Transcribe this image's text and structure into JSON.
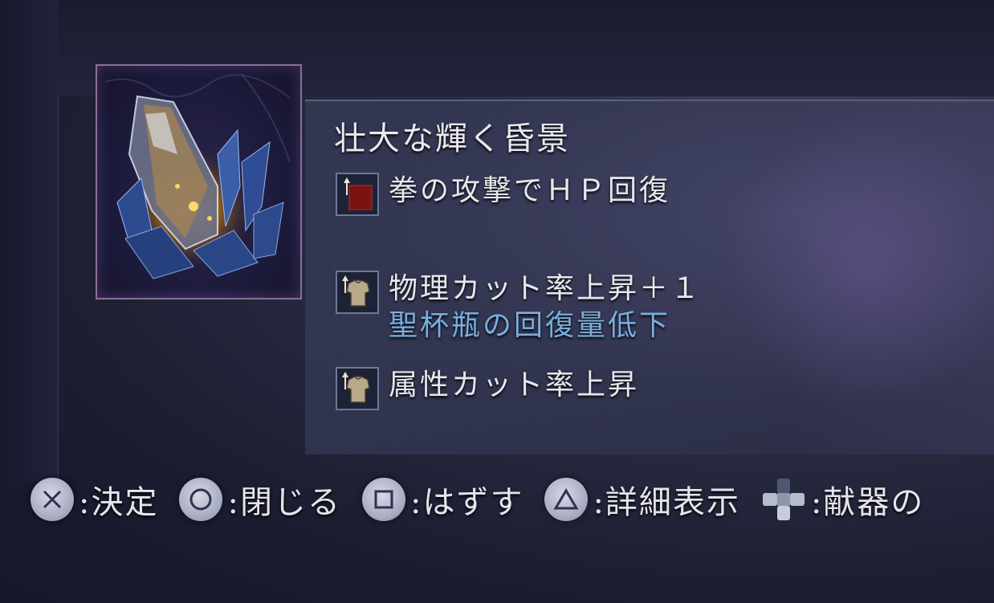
{
  "relic": {
    "name": "壮大な輝く昏景",
    "effects": [
      {
        "text": "拳の攻撃でＨＰ回復",
        "sub": "",
        "icon": "red-square-up-arrow-icon"
      },
      {
        "text": "物理カット率上昇＋１",
        "sub": "聖杯瓶の回復量低下",
        "icon": "armor-up-arrow-icon"
      },
      {
        "text": "属性カット率上昇",
        "sub": "",
        "icon": "armor-up-arrow-icon"
      }
    ]
  },
  "controls": [
    {
      "button": "cross-button-icon",
      "label": ":決定"
    },
    {
      "button": "circle-button-icon",
      "label": ":閉じる"
    },
    {
      "button": "square-button-icon",
      "label": ":はずす"
    },
    {
      "button": "triangle-button-icon",
      "label": ":詳細表示"
    },
    {
      "button": "dpad-icon",
      "label": ":献器の"
    }
  ],
  "colors": {
    "frame_border": "#8a6e9c",
    "subtext_blue": "#79aee0",
    "effect_red": "#7a1212"
  }
}
